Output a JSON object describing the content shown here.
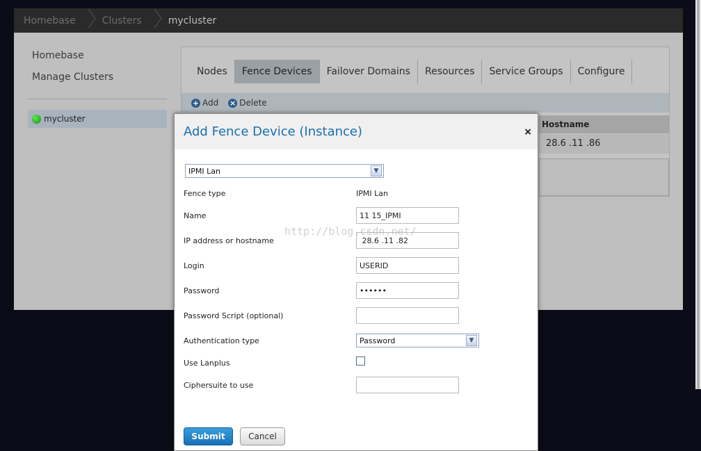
{
  "breadcrumb": [
    "Homebase",
    "Clusters",
    "mycluster"
  ],
  "side_nav": [
    "Homebase",
    "Manage Clusters"
  ],
  "cluster": {
    "name": "mycluster",
    "status_color": "#2fbf22"
  },
  "tabs": [
    {
      "label": "Nodes"
    },
    {
      "label": "Fence Devices",
      "active": true
    },
    {
      "label": "Failover Domains"
    },
    {
      "label": "Resources"
    },
    {
      "label": "Service Groups"
    },
    {
      "label": "Configure"
    }
  ],
  "toolbar": {
    "add_label": "Add",
    "delete_label": "Delete",
    "add_icon": "plus-icon",
    "delete_icon": "x-icon"
  },
  "table": {
    "hostname_header": "Hostname",
    "hostname_value": "28.6 .11 .86"
  },
  "dialog": {
    "title": "Add Fence Device (Instance)",
    "close_glyph": "×",
    "device_select": "IPMI Lan",
    "fence_type_label": "Fence type",
    "fence_type_value": "IPMI Lan",
    "name_label": "Name",
    "name_value": "11 15_IPMI",
    "ip_label": "IP address or hostname",
    "ip_value": " 28.6 .11 .82",
    "login_label": "Login",
    "login_value": "USERID",
    "password_label": "Password",
    "password_value": "••••••",
    "password_script_label": "Password Script (optional)",
    "password_script_value": "",
    "auth_type_label": "Authentication type",
    "auth_type_value": "Password",
    "lanplus_label": "Use Lanplus",
    "lanplus_checked": false,
    "ciphersuite_label": "Ciphersuite to use",
    "ciphersuite_value": "",
    "submit_label": "Submit",
    "cancel_label": "Cancel"
  },
  "watermark": "http://blog.csdn.net/",
  "colors": {
    "accent": "#1a6fae",
    "submit": "#1670b5"
  }
}
